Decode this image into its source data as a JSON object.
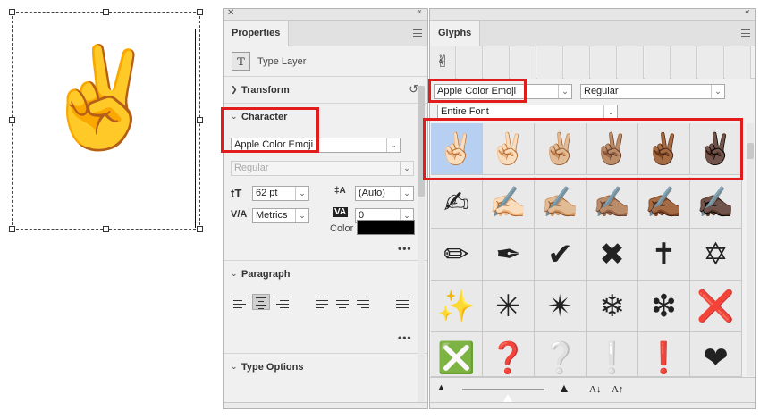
{
  "canvas": {
    "emoji": "✌️"
  },
  "properties": {
    "tab_label": "Properties",
    "layer_type_icon": "T",
    "layer_type_label": "Type Layer",
    "transform_label": "Transform",
    "character": {
      "section_label": "Character",
      "font_family": "Apple Color Emoji",
      "font_style": "Regular",
      "font_size": "62 pt",
      "leading": "(Auto)",
      "kerning": "Metrics",
      "tracking": "0",
      "color_label": "Color",
      "color_value": "#000000",
      "more": "•••"
    },
    "paragraph": {
      "section_label": "Paragraph",
      "more": "•••"
    },
    "type_options_label": "Type Options"
  },
  "glyphs": {
    "tab_label": "Glyphs",
    "recent": [
      "✌"
    ],
    "font_family": "Apple Color Emoji",
    "font_style": "Regular",
    "subset": "Entire Font",
    "cells": [
      "✌🏻",
      "✌🏻",
      "✌🏼",
      "✌🏽",
      "✌🏾",
      "✌🏿",
      "✍",
      "✍🏻",
      "✍🏼",
      "✍🏽",
      "✍🏾",
      "✍🏿",
      "✏",
      "✒",
      "✔",
      "✖",
      "✝",
      "✡",
      "✨",
      "✳",
      "✴",
      "❄",
      "❇",
      "❌",
      "❎",
      "❓",
      "❔",
      "❕",
      "❗",
      "❤"
    ],
    "highlight_color": "#e21b1b"
  }
}
